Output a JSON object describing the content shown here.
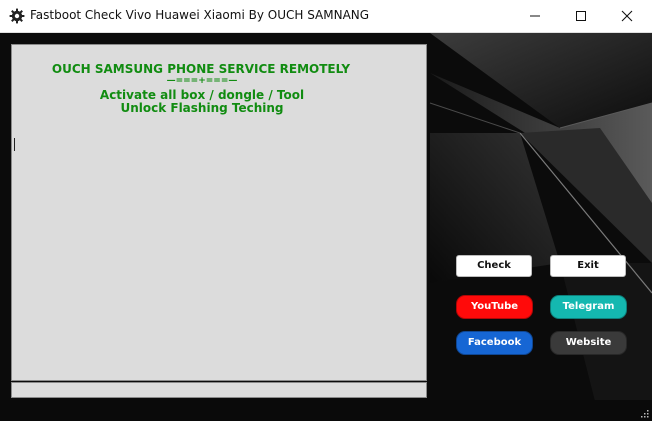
{
  "window": {
    "title": "Fastboot Check Vivo Huawei Xiaomi By OUCH SAMNANG",
    "icon": "gear-icon"
  },
  "controls": {
    "minimize": "minimize-icon",
    "maximize": "maximize-icon",
    "close": "close-icon"
  },
  "textbox": {
    "lines": [
      "OUCH SAMSUNG PHONE SERVICE REMOTELY",
      "—===+===—",
      "Activate all box / dongle / Tool",
      "Unlock Flashing Teching"
    ],
    "text_color": "#118c11",
    "background": "#dcdcdc"
  },
  "buttons": {
    "check": "Check",
    "exit": "Exit",
    "youtube": {
      "label": "YouTube",
      "color": "#ff0a0a"
    },
    "telegram": {
      "label": "Telegram",
      "color": "#14b8b0"
    },
    "facebook": {
      "label": "Facebook",
      "color": "#1666d4"
    },
    "website": {
      "label": "Website",
      "color": "#3a3a3a"
    }
  }
}
